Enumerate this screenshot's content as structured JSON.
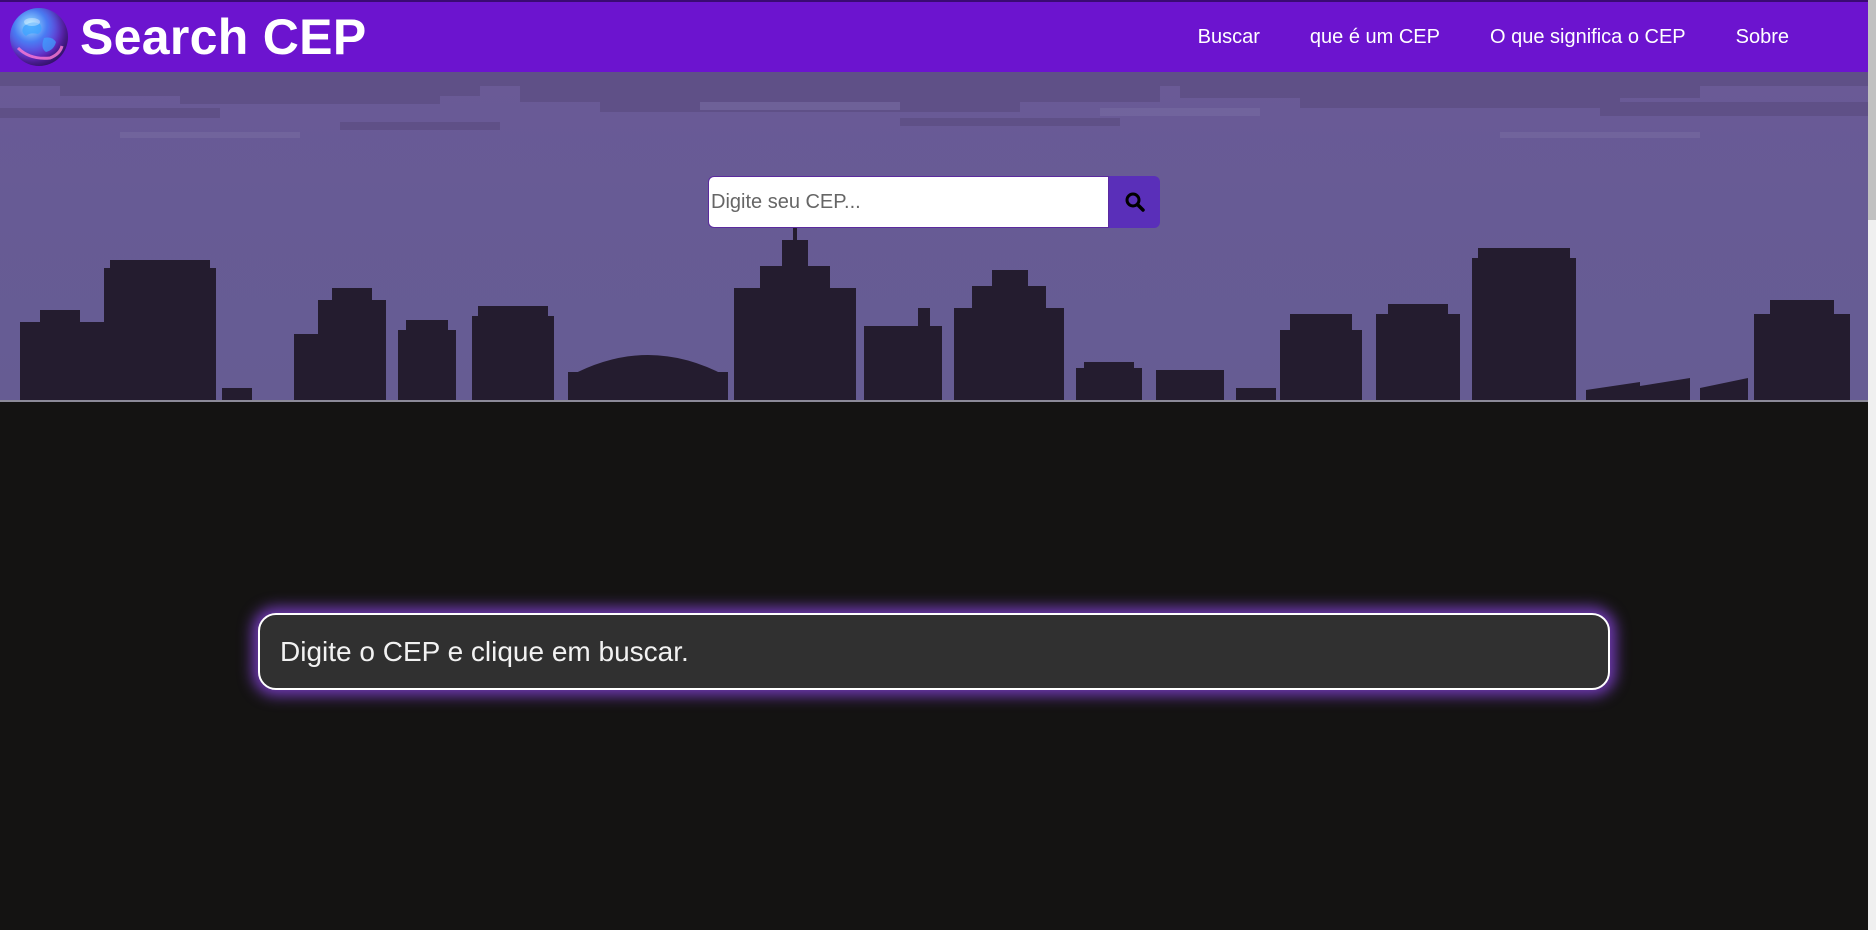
{
  "brand": {
    "title": "Search CEP",
    "logo_icon": "globe-icon"
  },
  "nav": {
    "items": [
      {
        "label": "Buscar"
      },
      {
        "label": "que é um CEP"
      },
      {
        "label": "O que significa o CEP"
      },
      {
        "label": "Sobre"
      }
    ]
  },
  "search": {
    "placeholder": "Digite seu CEP...",
    "value": "",
    "button_icon": "search-icon"
  },
  "result": {
    "message": "Digite o CEP e clique em buscar."
  },
  "colors": {
    "navbar": "#6c14cf",
    "search_button": "#5a2fb9",
    "page_background": "#141312",
    "result_glow": "#8c46e6"
  }
}
